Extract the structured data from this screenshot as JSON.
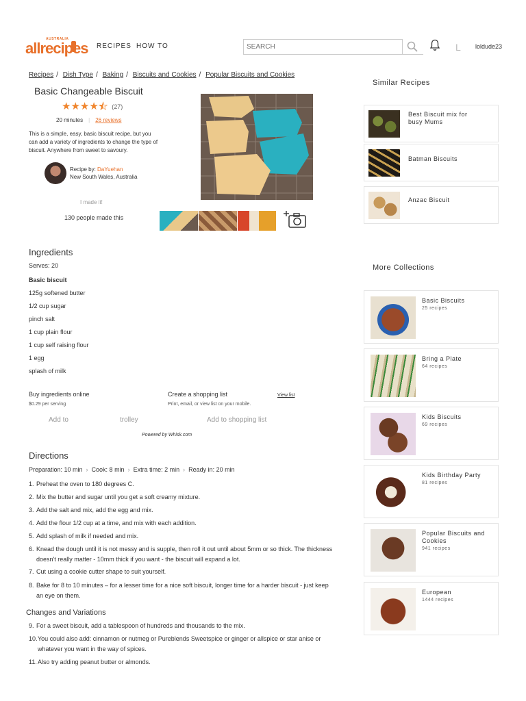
{
  "header": {
    "logo_country": "AUSTRALIA",
    "logo_text": "allrecipes",
    "nav": [
      "RECIPES",
      "HOW TO"
    ],
    "search_placeholder": "SEARCH",
    "user_initial": "L",
    "username": "loldude23"
  },
  "breadcrumb": [
    "Recipes",
    "Dish Type",
    "Baking",
    "Biscuits and Cookies",
    "Popular Biscuits and Cookies"
  ],
  "recipe": {
    "title": "Basic Changeable Biscuit",
    "rating": 4.5,
    "rating_count": "(27)",
    "time": "20 minutes",
    "reviews": "26 reviews",
    "description": "This is a simple, easy, basic biscuit recipe, but you can add a variety of ingredients to change the type of biscuit. Anywhere from sweet to savoury.",
    "author_label": "Recipe by: ",
    "author_name": "DaYuehan",
    "author_location": "New South Wales, Australia",
    "made_it": "I made it!",
    "made_count": "130 people made this"
  },
  "ingredients": {
    "title": "Ingredients",
    "serves": "Serves: 20",
    "group": "Basic biscuit",
    "items": [
      "125g softened butter",
      "1/2 cup sugar",
      "pinch salt",
      "1 cup plain flour",
      "1 cup self raising flour",
      "1 egg",
      "splash of milk"
    ]
  },
  "shopping": {
    "buy_label": "Buy ingredients online",
    "price": "$0.29 per serving",
    "create_label": "Create a shopping list",
    "create_sub": "Print, email, or view list on your mobile.",
    "view_list": "View list",
    "add_to": "Add to",
    "trolley": "trolley",
    "add_shopping": "Add to shopping list",
    "powered": "Powered by Whisk.com"
  },
  "directions": {
    "title": "Directions",
    "prep_label": "Preparation: 10 min",
    "cook_label": "Cook: 8 min",
    "extra_label": "Extra time: 2 min",
    "ready_label": "Ready in: 20 min",
    "steps": [
      {
        "num": "1.",
        "text": "Preheat the oven to 180 degrees C."
      },
      {
        "num": "2.",
        "text": "Mix the butter and sugar until you get a soft creamy mixture."
      },
      {
        "num": "3.",
        "text": "Add the salt and mix, add the egg and mix."
      },
      {
        "num": "4.",
        "text": "Add the flour 1/2 cup at a time, and mix with each addition."
      },
      {
        "num": "5.",
        "text": "Add splash of milk if needed and mix."
      },
      {
        "num": "6.",
        "text": "Knead the dough until it is not messy and is supple, then roll it out until about 5mm or so thick. The thickness",
        "text2": "doesn't really matter - 10mm thick if you want - the biscuit will expand a lot."
      },
      {
        "num": "7.",
        "text": "Cut using a cookie cutter shape to suit yourself."
      },
      {
        "num": "8.",
        "text": "Bake for 8 to 10 minutes – for a lesser time for a nice soft biscuit, longer time for a harder biscuit - just keep",
        "text2": "an eye on them."
      }
    ],
    "variations_title": "Changes and Variations",
    "variations": [
      {
        "num": "9.",
        "text": "For a sweet biscuit, add a tablespoon of hundreds and thousands to the mix."
      },
      {
        "num": "10.",
        "text": "You could also add: cinnamon or nutmeg or Pureblends Sweetspice or ginger or allspice or star anise or",
        "text2": "whatever you want in the way of spices."
      },
      {
        "num": "11.",
        "text": "Also try adding peanut butter or almonds."
      }
    ]
  },
  "similar": {
    "title": "Similar Recipes",
    "items": [
      {
        "title": "Best Biscuit mix for",
        "title2": "busy Mums"
      },
      {
        "title": "Batman Biscuits"
      },
      {
        "title": "Anzac Biscuit"
      }
    ]
  },
  "collections": {
    "title": "More Collections",
    "items": [
      {
        "title": "Basic Biscuits",
        "count": "25 recipes"
      },
      {
        "title": "Bring a Plate",
        "count": "64 recipes"
      },
      {
        "title": "Kids Biscuits",
        "count": "69 recipes"
      },
      {
        "title": "Kids Birthday Party",
        "count": "81 recipes"
      },
      {
        "title": "Popular Biscuits and Cookies",
        "count": "941 recipes"
      },
      {
        "title": "European",
        "count": "1444 recipes"
      }
    ]
  },
  "colors": {
    "accent": "#e8702a",
    "star": "#f0852d",
    "icing": "#2ab0c0"
  }
}
